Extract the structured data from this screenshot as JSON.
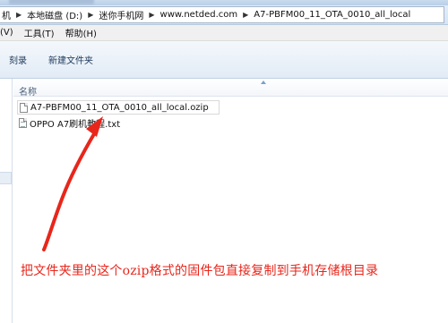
{
  "addressbar": {
    "crumbs": [
      "本地磁盘 (D:)",
      "迷你手机网",
      "www.netded.com",
      "A7-PBFM00_11_OTA_0010_all_local"
    ],
    "leading_char": "机"
  },
  "menubar": {
    "items": [
      "(V)",
      "工具(T)",
      "帮助(H)"
    ]
  },
  "toolbar": {
    "buttons": [
      "刻录",
      "新建文件夹"
    ]
  },
  "file_list": {
    "column_name": "名称",
    "files": [
      {
        "name": "A7-PBFM00_11_OTA_0010_all_local.ozip",
        "icon": "file-icon"
      },
      {
        "name": "OPPO A7刷机教程.txt",
        "icon": "text-file-icon"
      }
    ]
  },
  "annotation": {
    "text": "把文件夹里的这个ozip格式的固件包直接复制到手机存储根目录",
    "color": "#e8261b"
  }
}
